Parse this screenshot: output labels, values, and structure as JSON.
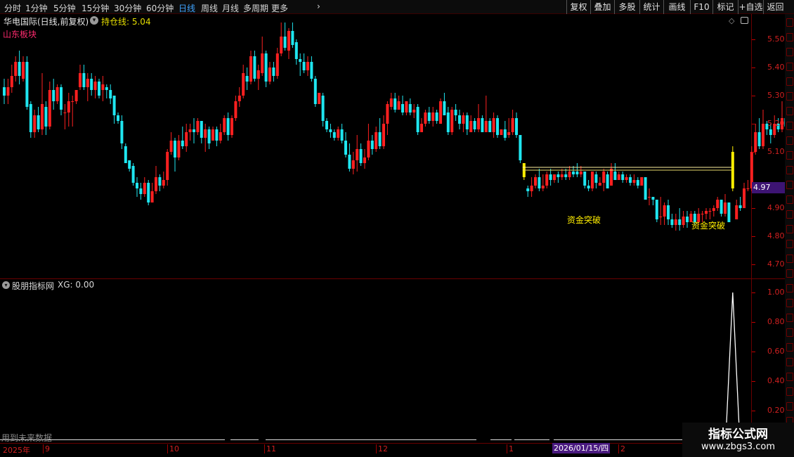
{
  "toolbar": {
    "periods": [
      {
        "label": "分时",
        "active": false
      },
      {
        "label": "1分钟",
        "active": false
      },
      {
        "label": "5分钟",
        "active": false
      },
      {
        "label": "15分钟",
        "active": false
      },
      {
        "label": "30分钟",
        "active": false
      },
      {
        "label": "60分钟",
        "active": false
      },
      {
        "label": "日线",
        "active": true
      },
      {
        "label": "周线",
        "active": false
      },
      {
        "label": "月线",
        "active": false
      },
      {
        "label": "多周期",
        "active": false
      },
      {
        "label": "更多",
        "active": false
      }
    ],
    "right_buttons": [
      "复权",
      "叠加",
      "多股",
      "统计",
      "画线",
      "F10",
      "标记",
      "+自选",
      "返回"
    ]
  },
  "main_panel": {
    "stock_name": "华电国际(日线,前复权)",
    "indicator_label": "持仓线: 5.04",
    "sector_label": "山东板块",
    "price_tag": "4.97",
    "price_axis": [
      "5.50",
      "5.40",
      "5.30",
      "5.20",
      "5.10",
      "4.90",
      "4.80",
      "4.70"
    ],
    "signal_labels": [
      "资金突破",
      "资金突破"
    ],
    "price_range": [
      4.65,
      5.58
    ]
  },
  "indicator_panel": {
    "title": "股朋指标网",
    "value_label": "XG: 0.00",
    "axis": [
      "1.00",
      "0.80",
      "0.60",
      "0.40",
      "0.20"
    ],
    "footer_note": "用到未来数据",
    "signal_index": 131
  },
  "time_axis": {
    "year_label": "2025年",
    "month_labels": [
      "9",
      "10",
      "11",
      "12",
      "1",
      "2"
    ],
    "cursor_date": "2026/01/15/四"
  },
  "watermark": {
    "title": "指标公式网",
    "url": "www.zbgs3.com"
  },
  "colors": {
    "up": "#ff2020",
    "down": "#1fe6f0",
    "signal": "#ffee00",
    "grid": "#6a0000",
    "accent_text": "#e5de00",
    "sector": "#ff2a6e"
  },
  "chart_data": {
    "type": "candlestick",
    "ylim": [
      4.65,
      5.58
    ],
    "candles": [
      [
        5.33,
        5.3,
        5.36,
        5.27
      ],
      [
        5.3,
        5.33,
        5.36,
        5.27
      ],
      [
        5.33,
        5.37,
        5.41,
        5.31
      ],
      [
        5.37,
        5.42,
        5.44,
        5.35
      ],
      [
        5.42,
        5.37,
        5.46,
        5.34
      ],
      [
        5.36,
        5.42,
        5.44,
        5.35
      ],
      [
        5.42,
        5.26,
        5.44,
        5.25
      ],
      [
        5.27,
        5.17,
        5.28,
        5.15
      ],
      [
        5.17,
        5.23,
        5.25,
        5.15
      ],
      [
        5.23,
        5.18,
        5.26,
        5.17
      ],
      [
        5.18,
        5.27,
        5.38,
        5.16
      ],
      [
        5.26,
        5.19,
        5.28,
        5.16
      ],
      [
        5.19,
        5.32,
        5.35,
        5.18
      ],
      [
        5.32,
        5.28,
        5.36,
        5.25
      ],
      [
        5.28,
        5.33,
        5.34,
        5.27
      ],
      [
        5.33,
        5.25,
        5.34,
        5.23
      ],
      [
        5.24,
        5.24,
        5.27,
        5.18
      ],
      [
        5.24,
        5.28,
        5.31,
        5.19
      ],
      [
        5.28,
        5.28,
        5.3,
        5.19
      ],
      [
        5.28,
        5.32,
        5.32,
        5.27
      ],
      [
        5.33,
        5.38,
        5.41,
        5.32
      ],
      [
        5.38,
        5.33,
        5.41,
        5.32
      ],
      [
        5.33,
        5.36,
        5.38,
        5.28
      ],
      [
        5.36,
        5.32,
        5.38,
        5.3
      ],
      [
        5.32,
        5.35,
        5.37,
        5.29
      ],
      [
        5.35,
        5.3,
        5.36,
        5.29
      ],
      [
        5.32,
        5.34,
        5.37,
        5.28
      ],
      [
        5.33,
        5.32,
        5.34,
        5.29
      ],
      [
        5.32,
        5.29,
        5.34,
        5.27
      ],
      [
        5.3,
        5.23,
        5.3,
        5.2
      ],
      [
        5.23,
        5.21,
        5.24,
        5.2
      ],
      [
        5.21,
        5.13,
        5.23,
        5.11
      ],
      [
        5.12,
        5.06,
        5.13,
        5.06
      ],
      [
        5.07,
        5.04,
        5.07,
        5.03
      ],
      [
        5.05,
        4.99,
        5.06,
        4.98
      ],
      [
        4.99,
        4.97,
        5.01,
        4.94
      ],
      [
        4.97,
        4.95,
        4.99,
        4.93
      ],
      [
        4.95,
        4.99,
        5.01,
        4.94
      ],
      [
        4.99,
        4.92,
        5.0,
        4.91
      ],
      [
        4.92,
        4.96,
        4.99,
        4.93
      ],
      [
        4.96,
        5.01,
        5.05,
        4.95
      ],
      [
        5.01,
        4.98,
        5.02,
        4.96
      ],
      [
        4.98,
        5.0,
        5.03,
        4.97
      ],
      [
        5.0,
        5.1,
        5.11,
        4.98
      ],
      [
        5.1,
        5.14,
        5.17,
        5.09
      ],
      [
        5.14,
        5.08,
        5.15,
        5.03
      ],
      [
        5.08,
        5.14,
        5.16,
        5.07
      ],
      [
        5.14,
        5.12,
        5.19,
        5.11
      ],
      [
        5.12,
        5.17,
        5.2,
        5.1
      ],
      [
        5.17,
        5.18,
        5.2,
        5.14
      ],
      [
        5.18,
        5.17,
        5.22,
        5.13
      ],
      [
        5.17,
        5.21,
        5.22,
        5.16
      ],
      [
        5.21,
        5.15,
        5.21,
        5.13
      ],
      [
        5.15,
        5.18,
        5.2,
        5.1
      ],
      [
        5.18,
        5.13,
        5.19,
        5.11
      ],
      [
        5.14,
        5.18,
        5.19,
        5.14
      ],
      [
        5.18,
        5.14,
        5.19,
        5.12
      ],
      [
        5.14,
        5.17,
        5.2,
        5.13
      ],
      [
        5.17,
        5.22,
        5.23,
        5.16
      ],
      [
        5.22,
        5.16,
        5.24,
        5.14
      ],
      [
        5.16,
        5.22,
        5.23,
        5.15
      ],
      [
        5.22,
        5.28,
        5.3,
        5.21
      ],
      [
        5.28,
        5.3,
        5.33,
        5.26
      ],
      [
        5.3,
        5.38,
        5.41,
        5.29
      ],
      [
        5.37,
        5.35,
        5.4,
        5.32
      ],
      [
        5.35,
        5.44,
        5.46,
        5.34
      ],
      [
        5.44,
        5.36,
        5.46,
        5.35
      ],
      [
        5.36,
        5.39,
        5.41,
        5.32
      ],
      [
        5.38,
        5.45,
        5.51,
        5.37
      ],
      [
        5.45,
        5.35,
        5.46,
        5.33
      ],
      [
        5.35,
        5.4,
        5.42,
        5.34
      ],
      [
        5.4,
        5.37,
        5.42,
        5.35
      ],
      [
        5.37,
        5.45,
        5.47,
        5.36
      ],
      [
        5.45,
        5.51,
        5.56,
        5.44
      ],
      [
        5.51,
        5.47,
        5.56,
        5.46
      ],
      [
        5.46,
        5.53,
        5.54,
        5.43
      ],
      [
        5.53,
        5.48,
        5.56,
        5.47
      ],
      [
        5.49,
        5.43,
        5.5,
        5.41
      ],
      [
        5.43,
        5.42,
        5.45,
        5.37
      ],
      [
        5.42,
        5.39,
        5.45,
        5.38
      ],
      [
        5.39,
        5.42,
        5.44,
        5.37
      ],
      [
        5.42,
        5.36,
        5.44,
        5.35
      ],
      [
        5.36,
        5.27,
        5.37,
        5.26
      ],
      [
        5.27,
        5.31,
        5.31,
        5.27
      ],
      [
        5.3,
        5.21,
        5.31,
        5.19
      ],
      [
        5.21,
        5.18,
        5.22,
        5.17
      ],
      [
        5.18,
        5.17,
        5.2,
        5.15
      ],
      [
        5.17,
        5.15,
        5.18,
        5.14
      ],
      [
        5.15,
        5.18,
        5.19,
        5.14
      ],
      [
        5.18,
        5.14,
        5.2,
        5.13
      ],
      [
        5.14,
        5.09,
        5.17,
        5.08
      ],
      [
        5.09,
        5.04,
        5.13,
        5.03
      ],
      [
        5.04,
        5.07,
        5.1,
        5.02
      ],
      [
        5.07,
        5.11,
        5.16,
        5.03
      ],
      [
        5.11,
        5.06,
        5.13,
        5.05
      ],
      [
        5.06,
        5.08,
        5.11,
        5.04
      ],
      [
        5.08,
        5.14,
        5.2,
        5.07
      ],
      [
        5.14,
        5.11,
        5.16,
        5.09
      ],
      [
        5.11,
        5.17,
        5.19,
        5.1
      ],
      [
        5.17,
        5.12,
        5.22,
        5.11
      ],
      [
        5.12,
        5.2,
        5.23,
        5.11
      ],
      [
        5.2,
        5.27,
        5.28,
        5.16
      ],
      [
        5.26,
        5.29,
        5.31,
        5.25
      ],
      [
        5.29,
        5.25,
        5.31,
        5.24
      ],
      [
        5.25,
        5.28,
        5.3,
        5.25
      ],
      [
        5.27,
        5.24,
        5.3,
        5.23
      ],
      [
        5.24,
        5.28,
        5.28,
        5.23
      ],
      [
        5.27,
        5.24,
        5.29,
        5.23
      ],
      [
        5.24,
        5.25,
        5.27,
        5.22
      ],
      [
        5.26,
        5.17,
        5.27,
        5.16
      ],
      [
        5.17,
        5.2,
        5.22,
        5.17
      ],
      [
        5.2,
        5.24,
        5.25,
        5.19
      ],
      [
        5.24,
        5.21,
        5.26,
        5.2
      ],
      [
        5.21,
        5.24,
        5.26,
        5.19
      ],
      [
        5.24,
        5.21,
        5.25,
        5.2
      ],
      [
        5.2,
        5.28,
        5.29,
        5.2
      ],
      [
        5.28,
        5.23,
        5.31,
        5.23
      ],
      [
        5.24,
        5.17,
        5.26,
        5.16
      ],
      [
        5.17,
        5.25,
        5.26,
        5.16
      ],
      [
        5.25,
        5.23,
        5.27,
        5.21
      ],
      [
        5.23,
        5.2,
        5.25,
        5.18
      ],
      [
        5.2,
        5.23,
        5.24,
        5.17
      ],
      [
        5.23,
        5.18,
        5.24,
        5.16
      ],
      [
        5.17,
        5.21,
        5.23,
        5.17
      ],
      [
        5.21,
        5.18,
        5.22,
        5.17
      ],
      [
        5.18,
        5.22,
        5.27,
        5.17
      ],
      [
        5.22,
        5.17,
        5.23,
        5.17
      ],
      [
        5.17,
        5.21,
        5.3,
        5.17
      ],
      [
        5.21,
        5.17,
        5.22,
        5.17
      ],
      [
        5.17,
        5.22,
        5.24,
        5.15
      ],
      [
        5.22,
        5.16,
        5.23,
        5.15
      ],
      [
        5.16,
        5.18,
        5.18,
        5.17
      ],
      [
        5.18,
        5.15,
        5.21,
        5.14
      ],
      [
        5.16,
        5.17,
        5.22,
        5.15
      ],
      [
        5.17,
        5.22,
        5.25,
        5.16
      ],
      [
        5.22,
        5.16,
        5.24,
        5.15
      ],
      [
        5.16,
        5.07,
        5.16,
        5.06
      ],
      [
        5.07,
        4.97,
        5.07,
        4.95
      ],
      [
        4.97,
        4.96,
        4.98,
        4.94
      ],
      [
        4.96,
        4.98,
        5.01,
        4.94
      ],
      [
        4.98,
        5.01,
        5.02,
        4.97
      ],
      [
        5.01,
        4.97,
        5.04,
        4.96
      ],
      [
        4.97,
        4.98,
        5.02,
        4.96
      ],
      [
        4.98,
        5.02,
        5.03,
        4.97
      ],
      [
        5.02,
        5.0,
        5.04,
        4.98
      ],
      [
        5.0,
        5.02,
        5.02,
        4.99
      ],
      [
        5.02,
        5.01,
        5.03,
        4.99
      ],
      [
        5.01,
        5.02,
        5.04,
        5.0
      ],
      [
        5.02,
        5.01,
        5.04,
        5.0
      ],
      [
        5.01,
        5.03,
        5.05,
        5.0
      ],
      [
        5.03,
        5.02,
        5.05,
        5.01
      ],
      [
        5.03,
        5.02,
        5.06,
        5.01
      ],
      [
        5.02,
        5.03,
        5.05,
        5.01
      ],
      [
        5.03,
        4.98,
        5.03,
        4.97
      ],
      [
        4.98,
        4.97,
        5.0,
        4.96
      ],
      [
        4.97,
        5.03,
        5.03,
        4.96
      ],
      [
        5.02,
        4.99,
        5.03,
        4.97
      ],
      [
        4.98,
        4.99,
        5.01,
        4.98
      ],
      [
        4.99,
        5.03,
        5.04,
        4.96
      ],
      [
        5.02,
        4.97,
        5.03,
        4.97
      ],
      [
        4.98,
        5.04,
        5.06,
        4.98
      ],
      [
        5.03,
        5.0,
        5.06,
        5.0
      ],
      [
        5.0,
        5.02,
        5.03,
        5.0
      ],
      [
        5.02,
        5.0,
        5.03,
        4.99
      ],
      [
        5.0,
        5.01,
        5.02,
        4.99
      ],
      [
        5.01,
        4.99,
        5.02,
        4.98
      ],
      [
        4.99,
        5.0,
        5.02,
        4.98
      ],
      [
        5.0,
        4.98,
        5.01,
        4.97
      ],
      [
        4.98,
        5.01,
        5.01,
        4.98
      ],
      [
        5.01,
        4.93,
        5.01,
        4.93
      ],
      [
        4.94,
        4.94,
        4.97,
        4.91
      ],
      [
        4.94,
        4.93,
        4.94,
        4.91
      ],
      [
        4.93,
        4.86,
        4.93,
        4.85
      ],
      [
        4.87,
        4.87,
        4.94,
        4.84
      ],
      [
        4.87,
        4.91,
        4.92,
        4.84
      ],
      [
        4.91,
        4.86,
        4.93,
        4.84
      ],
      [
        4.86,
        4.84,
        4.88,
        4.83
      ],
      [
        4.84,
        4.86,
        4.88,
        4.82
      ],
      [
        4.86,
        4.84,
        4.9,
        4.82
      ],
      [
        4.84,
        4.87,
        4.89,
        4.83
      ],
      [
        4.87,
        4.85,
        4.89,
        4.83
      ],
      [
        4.85,
        4.88,
        4.89,
        4.85
      ],
      [
        4.88,
        4.85,
        4.89,
        4.84
      ],
      [
        4.85,
        4.88,
        4.9,
        4.84
      ],
      [
        4.88,
        4.88,
        4.89,
        4.85
      ],
      [
        4.88,
        4.89,
        4.9,
        4.86
      ],
      [
        4.89,
        4.89,
        4.9,
        4.86
      ],
      [
        4.89,
        4.9,
        4.91,
        4.87
      ],
      [
        4.9,
        4.93,
        4.94,
        4.89
      ],
      [
        4.93,
        4.88,
        4.93,
        4.87
      ],
      [
        4.88,
        4.92,
        4.95,
        4.87
      ],
      [
        4.92,
        4.85,
        4.92,
        4.85
      ],
      [
        4.85,
        4.86,
        4.91,
        4.85
      ],
      [
        4.86,
        4.91,
        4.93,
        4.86
      ],
      [
        4.91,
        4.9,
        4.94,
        4.89
      ],
      [
        4.9,
        4.97,
        4.99,
        4.9
      ],
      [
        4.97,
        4.97,
        5.0,
        4.96
      ],
      [
        4.97,
        5.1,
        5.12,
        4.96
      ],
      [
        5.1,
        5.17,
        5.2,
        5.09
      ],
      [
        5.17,
        5.12,
        5.22,
        5.11
      ],
      [
        5.12,
        5.2,
        5.25,
        5.11
      ],
      [
        5.2,
        5.18,
        5.21,
        5.16
      ],
      [
        5.18,
        5.16,
        5.2,
        5.13
      ],
      [
        5.16,
        5.2,
        5.23,
        5.15
      ],
      [
        5.2,
        5.18,
        5.22,
        5.17
      ],
      [
        5.18,
        5.22,
        5.28,
        5.17
      ],
      [
        5.22,
        5.19,
        5.23,
        5.18
      ],
      [
        5.19,
        5.21,
        5.26,
        5.18
      ],
      [
        5.21,
        5.2,
        5.23,
        5.13
      ],
      [
        5.2,
        5.19,
        5.21,
        5.11
      ]
    ],
    "signals": [
      {
        "index": 137,
        "open": 5.06,
        "close": 5.01,
        "high": 5.06,
        "low": 5.0
      },
      {
        "index": 192,
        "open": 4.97,
        "close": 5.1,
        "high": 5.12,
        "low": 4.96
      }
    ],
    "signal_lines": [
      5.045,
      5.035
    ],
    "xg_series": {
      "peak_index": 192,
      "peak_value": 1.0
    }
  }
}
